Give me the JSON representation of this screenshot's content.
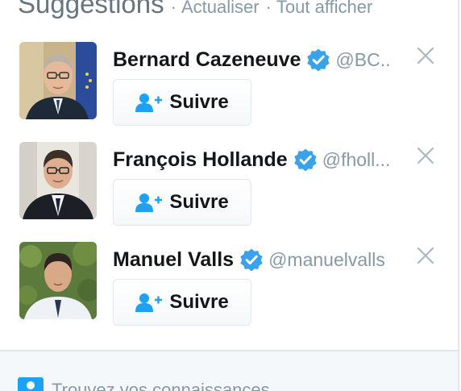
{
  "header": {
    "title": "Suggestions",
    "separator": "·",
    "refresh_label": "Actualiser",
    "view_all_label": "Tout afficher"
  },
  "suggestions": [
    {
      "name": "Bernard Cazeneuve",
      "handle": "@BC..",
      "verified": true,
      "follow_label": "Suivre"
    },
    {
      "name": "François Hollande",
      "handle": "@fholl...",
      "verified": true,
      "follow_label": "Suivre"
    },
    {
      "name": "Manuel Valls",
      "handle": "@manuelvalls",
      "verified": true,
      "follow_label": "Suivre"
    }
  ],
  "footer": {
    "find_friends_label": "Trouvez vos connaissances"
  },
  "colors": {
    "accent": "#1da1f2",
    "verified_badge": "#3aa2e8",
    "text_primary": "#14171a",
    "text_secondary": "#8899a6",
    "border": "#e1e8ed"
  },
  "icons": {
    "verified": "verified-badge-icon",
    "follow": "add-user-icon",
    "dismiss": "close-icon",
    "footer": "contacts-icon"
  }
}
